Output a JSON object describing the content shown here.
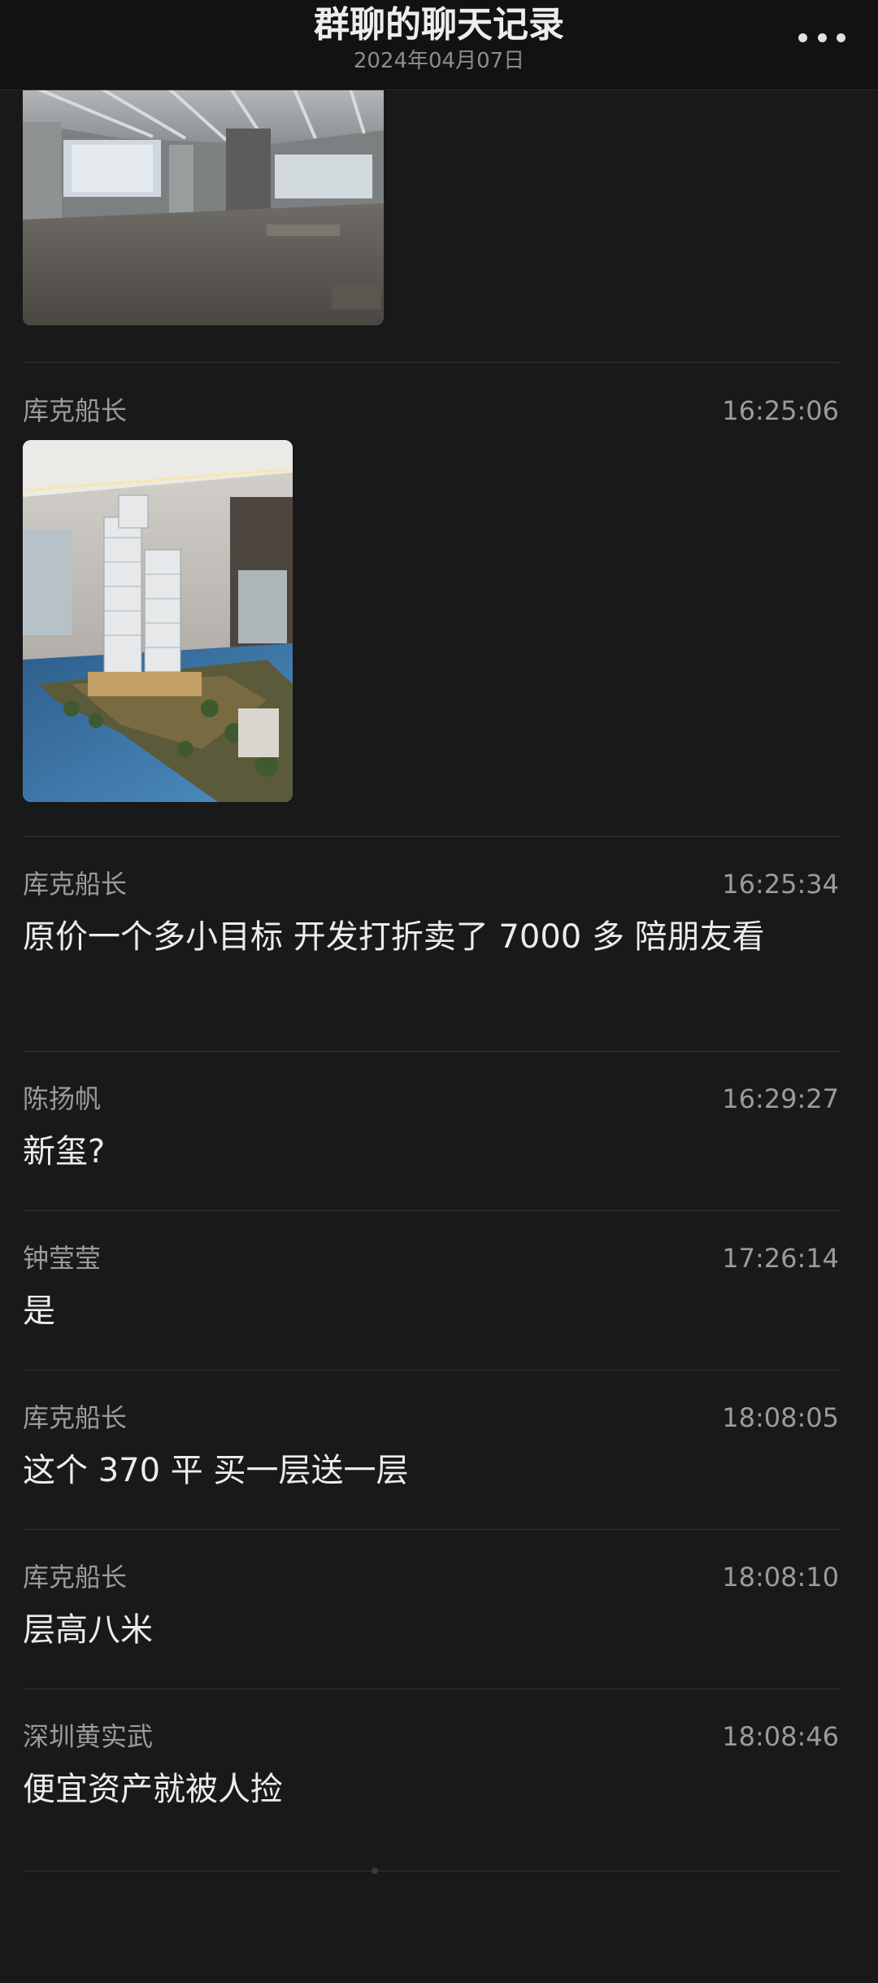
{
  "header": {
    "title": "群聊的聊天记录",
    "date": "2024年04月07日"
  },
  "icons": {
    "more": "more-horizontal-icon"
  },
  "messages": [
    {
      "sender": "库克船长",
      "time": "16:25:06",
      "type": "image",
      "image_desc": "sales-model-photo"
    },
    {
      "sender": "库克船长",
      "time": "16:25:34",
      "text": "原价一个多小目标 开发打折卖了 7000 多 陪朋友看"
    },
    {
      "sender": "陈扬帆",
      "time": "16:29:27",
      "text": "新玺?"
    },
    {
      "sender": "钟莹莹",
      "time": "17:26:14",
      "text": "是"
    },
    {
      "sender": "库克船长",
      "time": "18:08:05",
      "text": "这个 370 平 买一层送一层"
    },
    {
      "sender": "库克船长",
      "time": "18:08:10",
      "text": "层高八米"
    },
    {
      "sender": "深圳黄实武",
      "time": "18:08:46",
      "text": "便宜资产就被人捡"
    }
  ],
  "colors": {
    "background": "#191919",
    "topbar": "#121212",
    "divider": "#333333",
    "meta_text": "#9b9b9b",
    "body_text": "#ececec"
  }
}
